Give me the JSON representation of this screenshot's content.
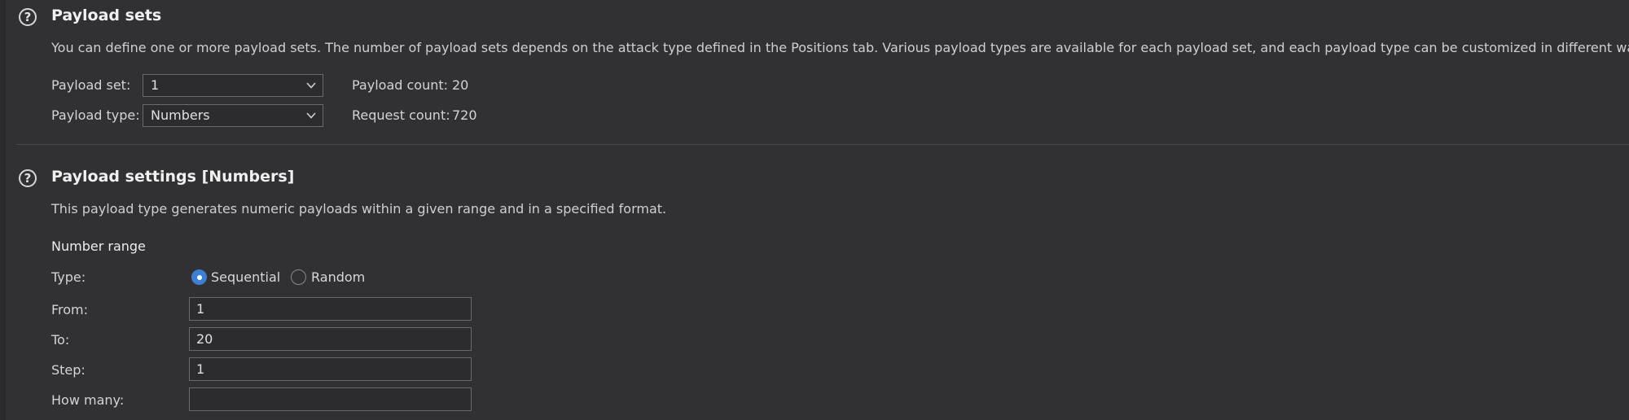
{
  "payload_sets": {
    "title": "Payload sets",
    "description": "You can define one or more payload sets. The number of payload sets depends on the attack type defined in the Positions tab. Various payload types are available for each payload set, and each payload type can be customized in different ways.",
    "payload_set_label": "Payload set:",
    "payload_set_value": "1",
    "payload_type_label": "Payload type:",
    "payload_type_value": "Numbers",
    "payload_count_label": "Payload count:",
    "payload_count_value": "20",
    "request_count_label": "Request count:",
    "request_count_value": "720"
  },
  "payload_settings": {
    "title": "Payload settings [Numbers]",
    "description": "This payload type generates numeric payloads within a given range and in a specified format.",
    "number_range_heading": "Number range",
    "type_label": "Type:",
    "type_options": [
      "Sequential",
      "Random"
    ],
    "type_selected": "Sequential",
    "from_label": "From:",
    "from_value": "1",
    "to_label": "To:",
    "to_value": "20",
    "step_label": "Step:",
    "step_value": "1",
    "how_many_label": "How many:",
    "how_many_value": ""
  },
  "icons": {
    "help": "help-circle-icon",
    "dropdown": "chevron-down-icon"
  },
  "colors": {
    "background": "#313134",
    "accent": "#3d7fd3",
    "input_border": "#6a6a6d"
  }
}
